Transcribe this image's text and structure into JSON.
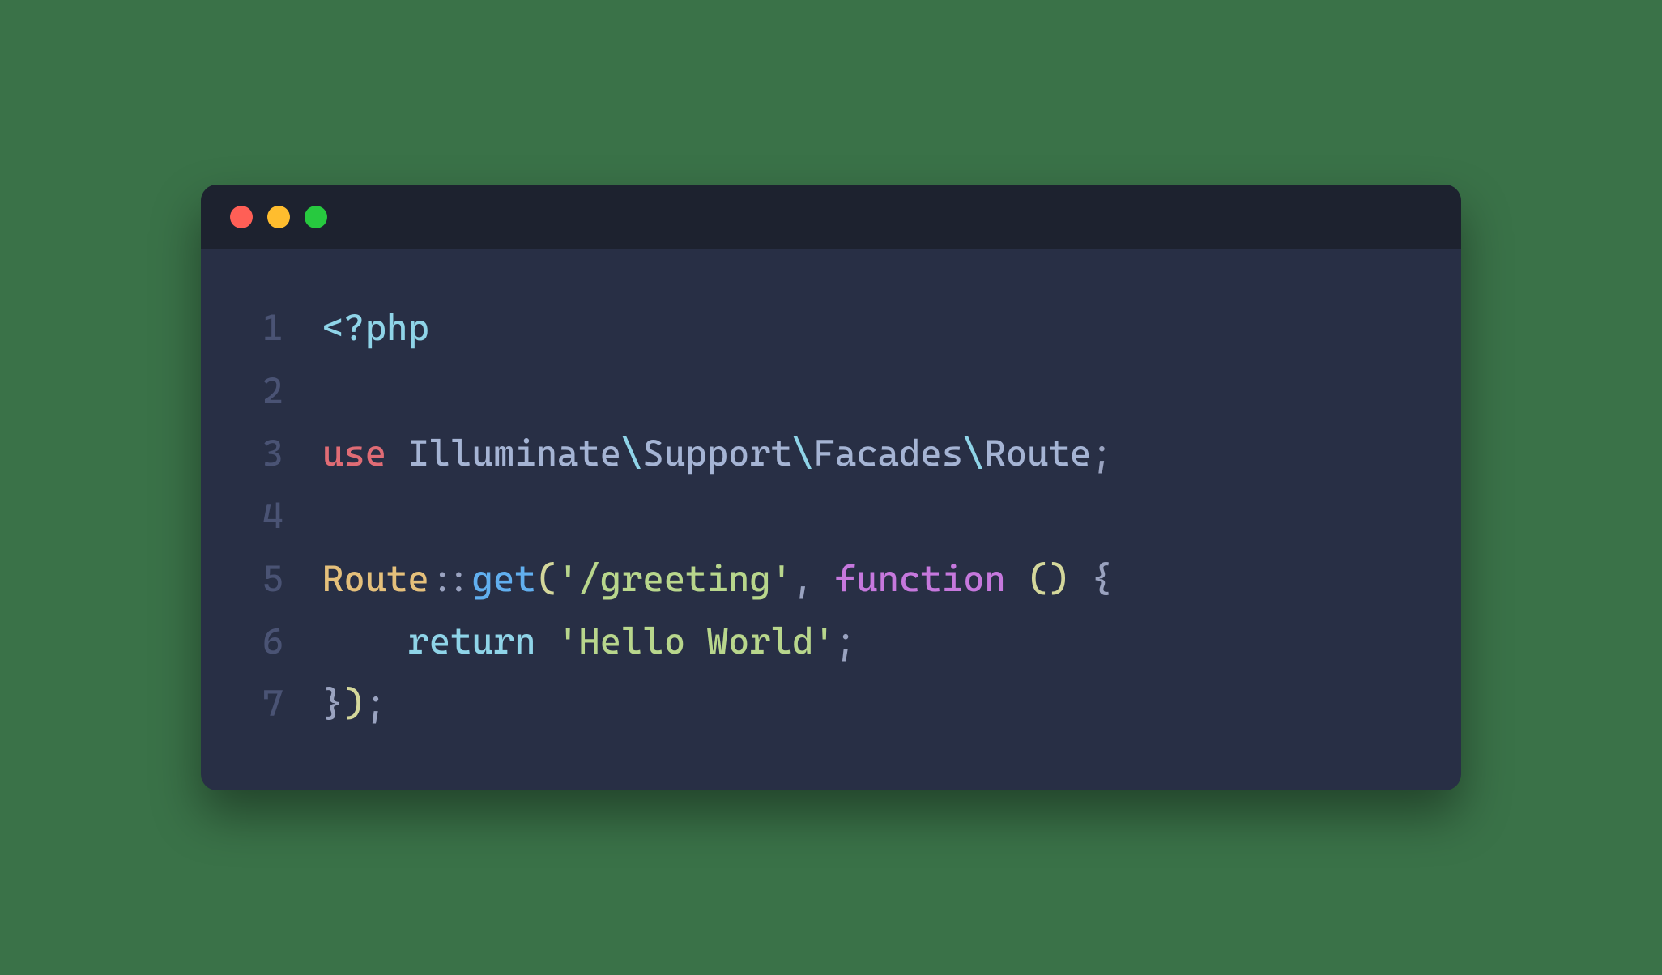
{
  "window": {
    "traffic_lights": {
      "red": "#ff5f56",
      "yellow": "#ffbd2e",
      "green": "#27c93f"
    }
  },
  "code": {
    "language": "php",
    "lines": [
      {
        "num": "1"
      },
      {
        "num": "2"
      },
      {
        "num": "3"
      },
      {
        "num": "4"
      },
      {
        "num": "5"
      },
      {
        "num": "6"
      },
      {
        "num": "7"
      }
    ],
    "tokens": {
      "php_open": "<?php",
      "use": "use",
      "space": " ",
      "illuminate": "Illuminate",
      "bs1": "\\",
      "support": "Support",
      "bs2": "\\",
      "facades": "Facades",
      "bs3": "\\",
      "route_ns": "Route",
      "semi1": ";",
      "route_class": "Route",
      "scope": "::",
      "get": "get",
      "lparen1": "(",
      "str_greeting": "'/greeting'",
      "comma": ",",
      "function": "function",
      "lparen2": "(",
      "rparen2": ")",
      "lbrace": "{",
      "indent": "    ",
      "return": "return",
      "str_hello": "'Hello World'",
      "semi2": ";",
      "rbrace": "}",
      "rparen3": ")",
      "semi3": ";"
    }
  }
}
